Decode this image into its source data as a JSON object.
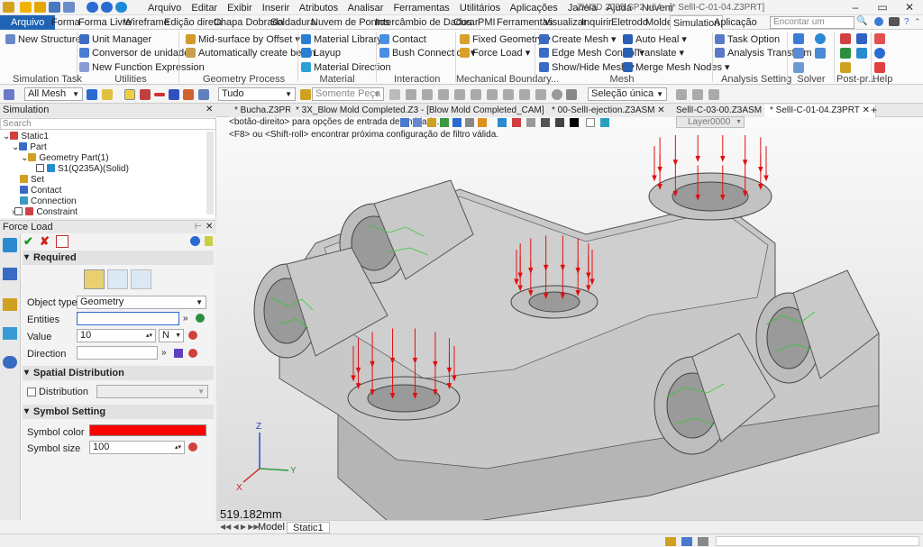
{
  "title_bar": {
    "menu": [
      "Arquivo",
      "Editar",
      "Exibir",
      "Inserir",
      "Atributos",
      "Analisar",
      "Ferramentas",
      "Utilitários",
      "Aplicações",
      "Janela",
      "Ajuda",
      "Nuvem"
    ],
    "window_title": "ZW3D 2025 SP2 x64 - [* SellI-C-01-04.Z3PRT]"
  },
  "ribbon_tabs": [
    "Arquivo",
    "Forma",
    "Forma Livre",
    "Wireframe",
    "Edição direta",
    "Chapa Dobrada",
    "Soldadura",
    "Nuvem de Pontos",
    "Intercâmbio de Dados",
    "Curar",
    "PMI",
    "Ferramentas",
    "Visualizar",
    "Inquirir",
    "Eletrodo",
    "Molde",
    "Simulation",
    "Aplicação"
  ],
  "active_tab": "Simulation",
  "search_placeholder": "Encontar um coman...",
  "ribbon": {
    "simulation_task": {
      "new_structure": "New Structure",
      "label": "Simulation Task"
    },
    "utilities": {
      "unit_manager": "Unit Manager",
      "unit_converter": "Conversor de unidades",
      "new_function": "New Function Expression",
      "label": "Utilities"
    },
    "geometry_process": {
      "mid_surface": "Mid-surface by Offset",
      "auto_beam": "Automatically create beam",
      "label": "Geometry Process"
    },
    "material": {
      "library": "Material Library",
      "layup": "Layup",
      "direction": "Material Direction",
      "label": "Material"
    },
    "interaction": {
      "contact": "Contact",
      "bush": "Bush Connection",
      "label": "Interaction"
    },
    "boundary": {
      "fixed": "Fixed Geometry",
      "force": "Force Load",
      "label": "Mechanical Boundary..."
    },
    "mesh": {
      "create": "Create Mesh",
      "edge_control": "Edge Mesh Control",
      "show_hide": "Show/Hide Mesh",
      "auto_heal": "Auto Heal",
      "translate": "Translate",
      "merge": "Merge Mesh Nodes",
      "label": "Mesh"
    },
    "analysis": {
      "task_option": "Task Option",
      "transform": "Analysis Transform",
      "label": "Analysis Setting"
    },
    "solver_label": "Solver",
    "post_label": "Post-pr...",
    "help_label": "Help"
  },
  "toolbar": {
    "filter": "All Mesh",
    "scope": "Tudo",
    "part_only": "Somente Peça",
    "selection": "Seleção única"
  },
  "simulation_panel": {
    "header": "Simulation",
    "search_placeholder": "Search"
  },
  "tree": [
    "Static1",
    "Part",
    "Geometry Part(1)",
    "S1(Q235A)(Solid)",
    "Set",
    "Contact",
    "Connection",
    "Constraint"
  ],
  "force_panel": {
    "header": "Force Load",
    "required": "Required",
    "object_type_label": "Object type",
    "object_type_value": "Geometry",
    "entities_label": "Entities",
    "value_label": "Value",
    "value": "10",
    "unit": "N",
    "direction_label": "Direction",
    "spatial": "Spatial Distribution",
    "distribution": "Distribution",
    "symbol_setting": "Symbol Setting",
    "symbol_color_label": "Symbol color",
    "symbol_color": "#ff0000",
    "symbol_size_label": "Symbol size",
    "symbol_size": "100"
  },
  "doc_tabs": [
    "* Bucha.Z3PRT",
    "* 3X_Blow Mold Completed.Z3 - [Blow Mold Completed_CAM]",
    "* 00-SellI-ejection.Z3ASM",
    "SellI-C-03-00.Z3ASM",
    "* SellI-C-01-04.Z3PRT"
  ],
  "active_doc": "* SellI-C-01-04.Z3PRT",
  "viewport": {
    "hint1": "<botão-direito> para opções de entrada de entidade.",
    "hint2": "<F8> ou <Shift-roll> encontrar próxima configuração de filtro válida.",
    "layer": "Layer0000",
    "scale": "519.182mm",
    "axis_x": "X",
    "axis_y": "Y",
    "axis_z": "Z"
  },
  "bottom_tabs": [
    "Model",
    "Static1"
  ],
  "colors": {
    "accent": "#1e63b5",
    "force": "#e01010",
    "mesh": "#33cc33"
  }
}
